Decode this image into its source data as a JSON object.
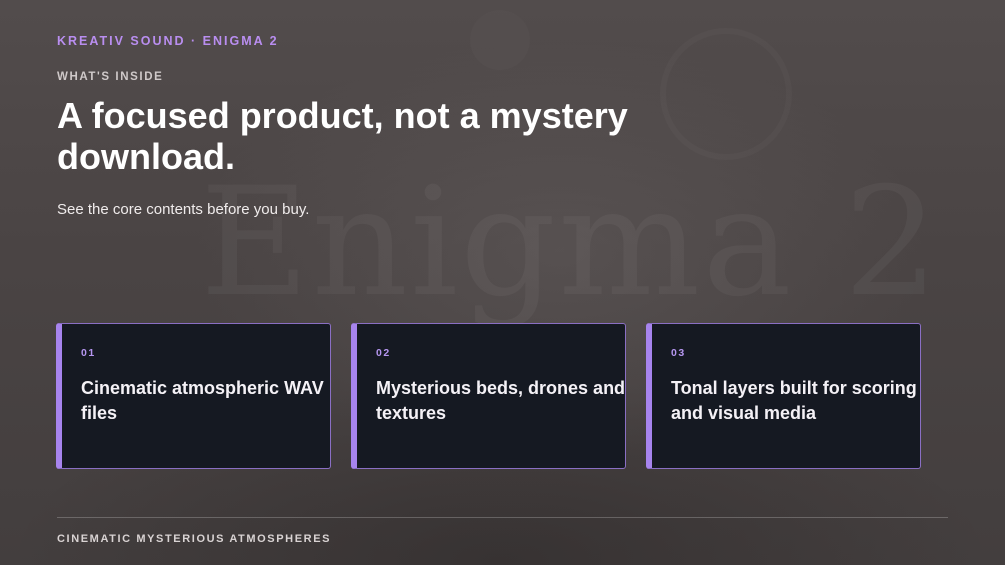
{
  "brand": "KREATIV SOUND · ENIGMA 2",
  "section": {
    "eyebrow": "WHAT'S INSIDE",
    "headline": "A focused product, not a mystery download.",
    "subtitle": "See the core contents before you buy."
  },
  "watermark": "Enigma 2",
  "cards": [
    {
      "number": "01",
      "text": "Cinematic atmospheric WAV files"
    },
    {
      "number": "02",
      "text": "Mysterious beds, drones and textures"
    },
    {
      "number": "03",
      "text": "Tonal layers built for scoring and visual media"
    }
  ],
  "footer": "CINEMATIC MYSTERIOUS ATMOSPHERES",
  "colors": {
    "accent": "#b98ef0",
    "card_background": "#151922",
    "card_border": "#a784ee",
    "background": "#4a4545"
  }
}
